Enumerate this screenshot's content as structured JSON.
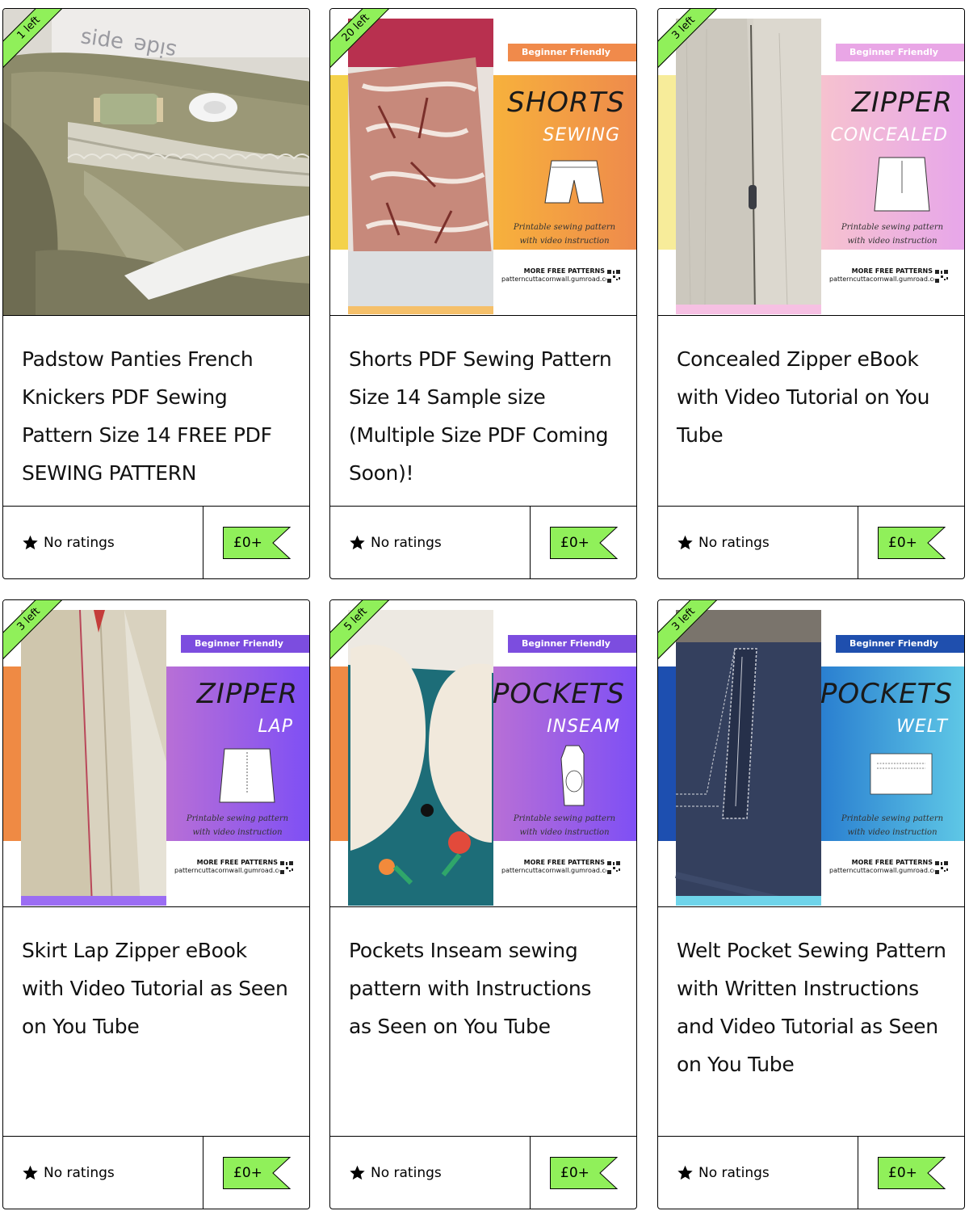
{
  "products": [
    {
      "stock": "1 left",
      "title": "Padstow Panties French Knickers PDF Sewing Pattern Size 14 FREE PDF SEWING PATTERN",
      "rating": "No ratings",
      "price": "£0+",
      "cover": null
    },
    {
      "stock": "20 left",
      "title": "Shorts PDF Sewing Pattern Size 14 Sample size (Multiple Size PDF Coming Soon)!",
      "rating": "No ratings",
      "price": "£0+",
      "cover": {
        "badge": "Beginner Friendly",
        "heading": "SHORTS",
        "subheading": "SEWING",
        "caption_line1": "Printable sewing pattern",
        "caption_line2": "with video instruction",
        "more": "MORE FREE PATTERNS",
        "site": "patterncuttacornwall.gumroad.com",
        "accent": "#f2a640",
        "badge_color": "#f08a4b",
        "garment_icon": "shorts-icon"
      }
    },
    {
      "stock": "3 left",
      "title": "Concealed Zipper eBook with Video Tutorial on You Tube",
      "rating": "No ratings",
      "price": "£0+",
      "cover": {
        "badge": "Beginner Friendly",
        "heading": "ZIPPER",
        "subheading": "CONCEALED",
        "caption_line1": "Printable sewing pattern",
        "caption_line2": "with video instruction",
        "more": "MORE FREE PATTERNS",
        "site": "patterncuttacornwall.gumroad.com",
        "accent": "#f1b6d4",
        "badge_color": "#e9a6e6",
        "garment_icon": "skirt-icon"
      }
    },
    {
      "stock": "3 left",
      "title": "Skirt Lap Zipper eBook with Video Tutorial as Seen on You Tube",
      "rating": "No ratings",
      "price": "£0+",
      "cover": {
        "badge": "Beginner Friendly",
        "heading": "ZIPPER",
        "subheading": "LAP",
        "caption_line1": "Printable sewing pattern",
        "caption_line2": "with video instruction",
        "more": "MORE FREE PATTERNS",
        "site": "patterncuttacornwall.gumroad.com",
        "accent": "#8b5cf6",
        "badge_color": "#7c4ddf",
        "garment_icon": "skirt-icon"
      }
    },
    {
      "stock": "5 left",
      "title": "Pockets Inseam sewing pattern with Instructions as Seen on You Tube",
      "rating": "No ratings",
      "price": "£0+",
      "cover": {
        "badge": "Beginner Friendly",
        "heading": "POCKETS",
        "subheading": "INSEAM",
        "caption_line1": "Printable sewing pattern",
        "caption_line2": "with video instruction",
        "more": "MORE FREE PATTERNS",
        "site": "patterncuttacornwall.gumroad.com",
        "accent": "#8b5cf6",
        "badge_color": "#7c4ddf",
        "garment_icon": "pocket-icon"
      }
    },
    {
      "stock": "3 left",
      "title": "Welt Pocket Sewing Pattern with Written Instructions and Video Tutorial as Seen on You Tube",
      "rating": "No ratings",
      "price": "£0+",
      "cover": {
        "badge": "Beginner Friendly",
        "heading": "POCKETS",
        "subheading": "WELT",
        "caption_line1": "Printable sewing pattern",
        "caption_line2": "with video instruction",
        "more": "MORE FREE PATTERNS",
        "site": "patterncuttacornwall.gumroad.com",
        "accent": "#3aa6dc",
        "badge_color": "#1f4fae",
        "garment_icon": "welt-pocket-icon"
      }
    }
  ],
  "colors": {
    "ribbon": "#90f05a",
    "price_tag": "#90f05a",
    "border": "#000000"
  }
}
